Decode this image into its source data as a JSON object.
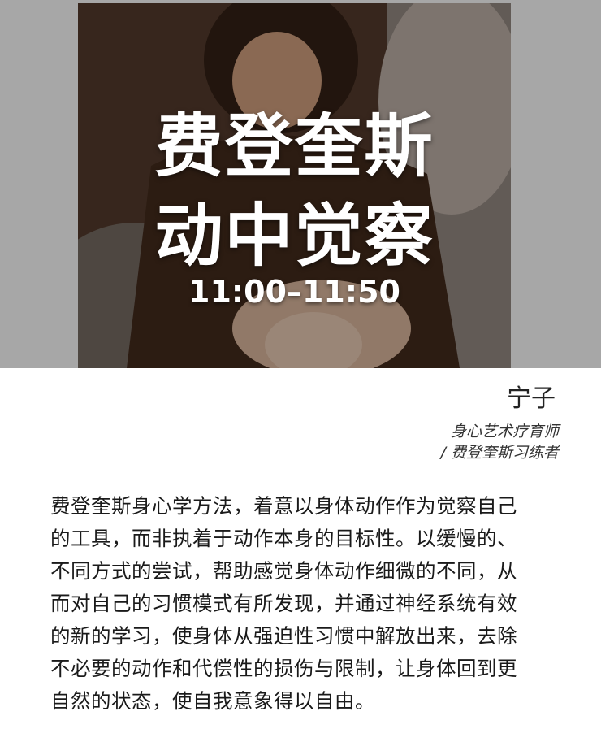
{
  "header": {
    "title_line1": "费登奎斯",
    "title_line2": "动中觉察",
    "time": "11:00–11:50"
  },
  "teacher": {
    "name": "宁子",
    "role_line1": "身心艺术疗育师",
    "role_line2": "/ 费登奎斯习练者"
  },
  "description": {
    "lines": [
      "费登奎斯身心学方法，着意以身体动作作为觉察自己",
      "的工具，而非执着于动作本身的目标性。以缓慢的、",
      "不同方式的尝试，帮助感觉身体动作细微的不同，从",
      "而对自己的习惯模式有所发现，并通过神经系统有效",
      "的新的学习，使身体从强迫性习惯中解放出来，去除",
      "不必要的动作和代偿性的损伤与限制，让身体回到更",
      "自然的状态，使自我意象得以自由。"
    ]
  }
}
